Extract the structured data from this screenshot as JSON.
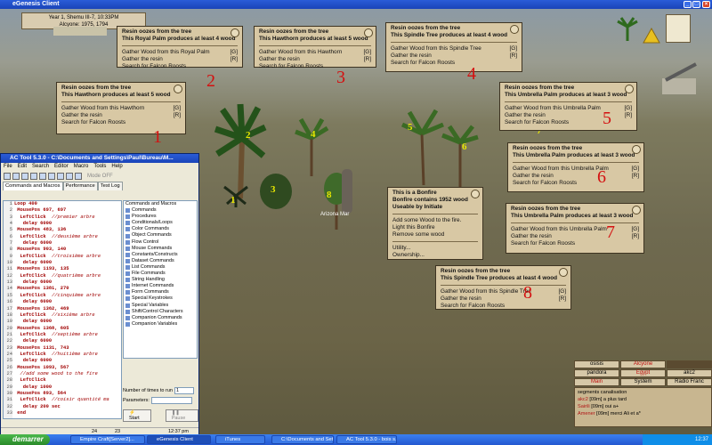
{
  "window": {
    "title": "eGenesis Client"
  },
  "date": {
    "line1": "Year 1, Shemu III-7, 10:33PM",
    "line2": "Alcyone: 1975, 1794"
  },
  "popups": [
    {
      "id": "p1",
      "title": "Resin oozes from the tree",
      "subtitle": "This Royal Palm produces at least 4 wood",
      "actions": [
        {
          "label": "Gather Wood from this Royal Palm",
          "key": "[G]"
        },
        {
          "label": "Gather the resin",
          "key": "[R]"
        },
        {
          "label": "Search for Falcon Roosts",
          "key": ""
        }
      ]
    },
    {
      "id": "p2",
      "title": "Resin oozes from the tree",
      "subtitle": "This Hawthorn produces at least 5 wood",
      "actions": [
        {
          "label": "Gather Wood from this Hawthorn",
          "key": "[G]"
        },
        {
          "label": "Gather the resin",
          "key": "[R]"
        },
        {
          "label": "Search for Falcon Roosts",
          "key": ""
        }
      ]
    },
    {
      "id": "p3",
      "title": "Resin oozes from the tree",
      "subtitle": "This Spindle Tree produces at least 4 wood",
      "actions": [
        {
          "label": "Gather Wood from this Spindle Tree",
          "key": "[G]"
        },
        {
          "label": "Gather the resin",
          "key": "[R]"
        },
        {
          "label": "Search for Falcon Roosts",
          "key": ""
        }
      ]
    },
    {
      "id": "p4",
      "title": "Resin oozes from the tree",
      "subtitle": "This Hawthorn produces at least 5 wood",
      "actions": [
        {
          "label": "Gather Wood from this Hawthorn",
          "key": "[G]"
        },
        {
          "label": "Gather the resin",
          "key": "[R]"
        },
        {
          "label": "Search for Falcon Roosts",
          "key": ""
        }
      ]
    },
    {
      "id": "p5",
      "title": "Resin oozes from the tree",
      "subtitle": "This Umbrella Palm produces at least 3 wood",
      "actions": [
        {
          "label": "Gather Wood from this Umbrella Palm",
          "key": "[G]"
        },
        {
          "label": "Gather the resin",
          "key": "[R]"
        },
        {
          "label": "Search for Falcon Roosts",
          "key": ""
        }
      ]
    },
    {
      "id": "p6",
      "title": "Resin oozes from the tree",
      "subtitle": "This Umbrella Palm produces at least 3 wood",
      "actions": [
        {
          "label": "Gather Wood from this Umbrella Palm",
          "key": "[G]"
        },
        {
          "label": "Gather the resin",
          "key": "[R]"
        },
        {
          "label": "Search for Falcon Roosts",
          "key": ""
        }
      ]
    },
    {
      "id": "p7",
      "title": "Resin oozes from the tree",
      "subtitle": "This Umbrella Palm produces at least 3 wood",
      "actions": [
        {
          "label": "Gather Wood from this Umbrella Palm",
          "key": "[G]"
        },
        {
          "label": "Gather the resin",
          "key": "[R]"
        },
        {
          "label": "Search for Falcon Roosts",
          "key": ""
        }
      ]
    },
    {
      "id": "p8",
      "title": "Resin oozes from the tree",
      "subtitle": "This Spindle Tree produces at least 4 wood",
      "actions": [
        {
          "label": "Gather Wood from this Spindle Tree",
          "key": "[G]"
        },
        {
          "label": "Gather the resin",
          "key": "[R]"
        },
        {
          "label": "Search for Falcon Roosts",
          "key": ""
        }
      ]
    }
  ],
  "bonfire": {
    "title": "This is a Bonfire",
    "line2": "Bonfire contains 1952 wood",
    "line3": "Useable by Initiate",
    "actions": [
      "Add some Wood to the fire.",
      "Light this Bonfire",
      "Remove some wood",
      "Utility...",
      "Ownership..."
    ]
  },
  "numbers": [
    "1",
    "2",
    "3",
    "4",
    "5",
    "6",
    "7",
    "8"
  ],
  "tree_labels": [
    "1",
    "2",
    "3",
    "4",
    "5",
    "6",
    "7",
    "8"
  ],
  "player_tag": "Arizona Mar",
  "actool": {
    "title": "AC Tool 5.3.0 - C:\\Documents and Settings\\Paul\\Bureau\\M...",
    "menu": [
      "File",
      "Edit",
      "Search",
      "Editor",
      "Macro",
      "Tools",
      "Help"
    ],
    "mode": "Mode OFF",
    "tabs": [
      "Commands and Macros",
      "Performance",
      "Test Log"
    ],
    "lines": [
      "1",
      "2",
      "3",
      "4",
      "5",
      "6",
      "7",
      "8",
      "9",
      "10",
      "11",
      "12",
      "13",
      "14",
      "15",
      "16",
      "17",
      "18",
      "19",
      "20",
      "21",
      "22",
      "23",
      "24",
      "25",
      "26",
      "27",
      "28",
      "29",
      "30",
      "31",
      "32",
      "33"
    ],
    "code": [
      {
        "k": "Loop 400",
        "c": ""
      },
      {
        "k": " MousePos 697, 697",
        "c": ""
      },
      {
        "k": "  LeftClick",
        "c": "  //premier arbre"
      },
      {
        "k": "   delay 6000",
        "c": ""
      },
      {
        "k": " MousePos 483, 136",
        "c": ""
      },
      {
        "k": "  LeftClick",
        "c": "  //deuxième arbre"
      },
      {
        "k": "   delay 6000",
        "c": ""
      },
      {
        "k": " MousePos 903, 140",
        "c": ""
      },
      {
        "k": "  LeftClick",
        "c": "  //troisième arbre"
      },
      {
        "k": "   delay 6000",
        "c": ""
      },
      {
        "k": " MousePos 1193, 135",
        "c": ""
      },
      {
        "k": "  LeftClick",
        "c": "  //quatrième arbre"
      },
      {
        "k": "   delay 6000",
        "c": ""
      },
      {
        "k": " MousePos 1381, 270",
        "c": ""
      },
      {
        "k": "  LeftClick",
        "c": "  //cinquième arbre"
      },
      {
        "k": "   delay 6000",
        "c": ""
      },
      {
        "k": " MousePos 1362, 469",
        "c": ""
      },
      {
        "k": "  LeftClick",
        "c": "  //sixième arbre"
      },
      {
        "k": "   delay 6000",
        "c": ""
      },
      {
        "k": " MousePos 1368, 605",
        "c": ""
      },
      {
        "k": "  LeftClick",
        "c": "  //septième arbre"
      },
      {
        "k": "   delay 6000",
        "c": ""
      },
      {
        "k": " MousePos 1131, 743",
        "c": ""
      },
      {
        "k": "  LeftClick",
        "c": "  //huitième arbre"
      },
      {
        "k": "   delay 6000",
        "c": ""
      },
      {
        "k": " MousePos 1093, 567",
        "c": ""
      },
      {
        "k": "",
        "c": "  //add some wood to the fire"
      },
      {
        "k": "  LeftClick",
        "c": ""
      },
      {
        "k": "   delay 1000",
        "c": ""
      },
      {
        "k": " MousePos 893, 564",
        "c": ""
      },
      {
        "k": "  LeftClick",
        "c": "  //coisir quantité ma"
      },
      {
        "k": "   delay 200 sec",
        "c": ""
      },
      {
        "k": " end",
        "c": ""
      }
    ],
    "commands": [
      "Commands and Macros",
      "Commands",
      "Procedures",
      "Conditionals/Loops",
      "Color Commands",
      "Object Commands",
      "Flow Control",
      "Mouse Commands",
      "Constants/Constructs",
      "Dataset Commands",
      "List Commands",
      "File Commands",
      "String Handling",
      "Internet Commands",
      "Form Commands",
      "Special Keystrokes",
      "Special Variables",
      "Shift/Control Characters",
      "Companion Commands",
      "Companion Variables"
    ],
    "times_label": "Number of times to run",
    "times_value": "1",
    "params_label": "Parameters:",
    "start": "Start",
    "pause": "Pause",
    "status": [
      "24",
      "23",
      "12:37 pm"
    ]
  },
  "chat": {
    "tabs": [
      "osisis",
      "Alcyone",
      "",
      "pandora",
      "Egypt",
      "akc2",
      "Main",
      "System",
      "Radio Franc"
    ],
    "log": [
      {
        "name": "",
        "text": "segments canalisation"
      },
      {
        "name": "akc2",
        "text": " [09m] a plus tard"
      },
      {
        "name": "Sairili",
        "text": " [09m] oui a+"
      },
      {
        "name": "Amener",
        "text": " [09m] merci Ali et a*"
      }
    ]
  },
  "taskbar": {
    "start": "demarrer",
    "tasks": [
      "Empire Craft[Server2]...",
      "eGenesis Client",
      "iTunes",
      "C:\\Documents and Sett...",
      "AC Tool 5.3.0 - bois s..."
    ],
    "clock": "12:37"
  }
}
